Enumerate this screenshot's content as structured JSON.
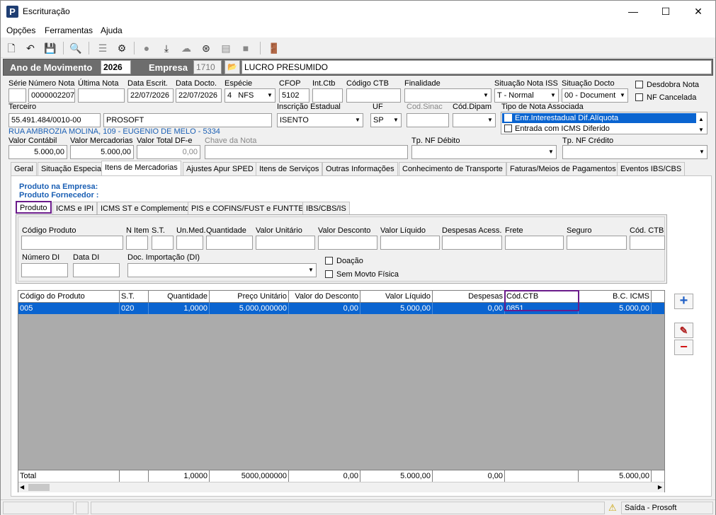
{
  "window": {
    "title": "Escrituração",
    "app_icon_letter": "P",
    "minimize": "—",
    "maximize": "☐",
    "close": "✕"
  },
  "menu": [
    "Opções",
    "Ferramentas",
    "Ajuda"
  ],
  "header": {
    "ano_label": "Ano de Movimento",
    "ano_value": "2026",
    "empresa_label": "Empresa",
    "empresa_code": "1710",
    "empresa_name": "LUCRO PRESUMIDO"
  },
  "fields": {
    "serie": {
      "label": "Série",
      "value": ""
    },
    "numero_nota": {
      "label": "Número Nota",
      "value": "0000002207"
    },
    "ultima_nota": {
      "label": "Última Nota",
      "value": ""
    },
    "data_escrit": {
      "label": "Data Escrit.",
      "value": "22/07/2026"
    },
    "data_docto": {
      "label": "Data Docto.",
      "value": "22/07/2026"
    },
    "especie": {
      "label": "Espécie",
      "code": "4",
      "value": "NFS"
    },
    "cfop": {
      "label": "CFOP",
      "value": "5102"
    },
    "int_ctb": {
      "label": "Int.Ctb",
      "value": ""
    },
    "codigo_ctb": {
      "label": "Código CTB",
      "value": ""
    },
    "finalidade": {
      "label": "Finalidade",
      "value": ""
    },
    "situacao_iss": {
      "label": "Situação Nota ISS",
      "value": "T - Normal"
    },
    "situacao_docto": {
      "label": "Situação Docto",
      "value": "00 - Document"
    },
    "desdobra": {
      "label": "Desdobra Nota"
    },
    "nf_cancelada": {
      "label": "NF Cancelada"
    },
    "terceiro": {
      "label": "Terceiro",
      "cnpj": "55.491.484/0010-00",
      "name": "PROSOFT"
    },
    "inscricao": {
      "label": "Inscrição Estadual",
      "value": "ISENTO"
    },
    "uf": {
      "label": "UF",
      "value": "SP"
    },
    "cod_sinac": {
      "label": "Cod.Sinac",
      "value": ""
    },
    "cod_dipam": {
      "label": "Cód.Dipam",
      "value": ""
    },
    "tipo_nota": {
      "label": "Tipo de Nota Associada",
      "items": [
        "Entr.Interestadual Dif.Alíquota",
        "Entrada com ICMS Diferido"
      ]
    },
    "address": "RUA AMBROZIA MOLINA, 109 - EUGENIO DE MELO - 5334",
    "valor_contabil": {
      "label": "Valor Contábil",
      "value": "5.000,00"
    },
    "valor_mercadorias": {
      "label": "Valor Mercadorias",
      "value": "5.000,00"
    },
    "valor_total_dfe": {
      "label": "Valor Total DF-e",
      "value": "0,00"
    },
    "chave_nota": {
      "label": "Chave da Nota",
      "value": ""
    },
    "tp_nf_debito": {
      "label": "Tp. NF Débito",
      "value": ""
    },
    "tp_nf_credito": {
      "label": "Tp. NF Crédito",
      "value": ""
    }
  },
  "tabs": [
    "Geral",
    "Situação Especial",
    "Itens de Mercadorias",
    "Ajustes Apur SPED",
    "Itens de Serviços",
    "Outras Informações",
    "Conhecimento de Transporte",
    "Faturas/Meios de Pagamentos",
    "Eventos IBS/CBS"
  ],
  "produto_empresa": "Produto na Empresa:",
  "produto_fornecedor": "Produto Fornecedor :",
  "subtabs": [
    "Produto",
    "ICMS e IPI",
    "ICMS ST e Complemento",
    "PIS e COFINS/FUST e FUNTTEL",
    "IBS/CBS/IS"
  ],
  "produto_fields": [
    "Código Produto",
    "N Item",
    "S.T.",
    "Un.Med.",
    "Quantidade",
    "Valor Unitário",
    "Valor Desconto",
    "Valor Líquido",
    "Despesas Acess.",
    "Frete",
    "Seguro",
    "Cód. CTB"
  ],
  "di_fields": {
    "numero_di": "Número DI",
    "data_di": "Data DI",
    "doc_importacao": "Doc. Importação (DI)",
    "doacao": "Doação",
    "sem_movto": "Sem Movto Física"
  },
  "grid": {
    "columns": [
      "Código do Produto",
      "S.T.",
      "Quantidade",
      "Preço Unitário",
      "Valor do Desconto",
      "Valor Líquido",
      "Despesas",
      "Cód.CTB",
      "B.C. ICMS"
    ],
    "rows": [
      [
        "005",
        "020",
        "1,0000",
        "5.000,000000",
        "0,00",
        "5.000,00",
        "0,00",
        "0851",
        "5.000,00"
      ]
    ],
    "total": [
      "Total",
      "",
      "1,0000",
      "5000,000000",
      "0,00",
      "5.000,00",
      "0,00",
      "",
      "5.000,00"
    ]
  },
  "status": {
    "text": "Saída - Prosoft"
  },
  "colors": {
    "dark_header": "#6d6d6d",
    "selection": "#0a64d0",
    "highlight_border": "#6a1b8a",
    "link": "#1a5fb4"
  }
}
